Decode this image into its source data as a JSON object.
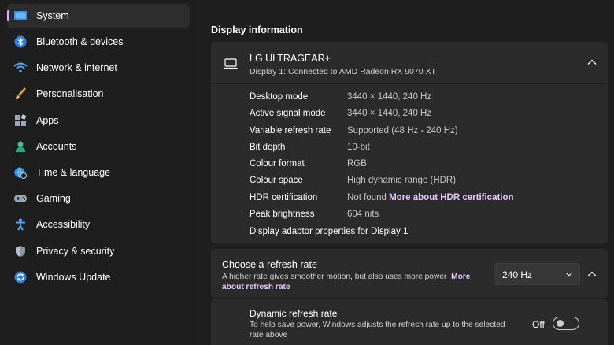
{
  "sidebar": {
    "items": [
      {
        "label": "System",
        "icon": "system-icon",
        "selected": true
      },
      {
        "label": "Bluetooth & devices",
        "icon": "bluetooth-icon"
      },
      {
        "label": "Network & internet",
        "icon": "wifi-icon"
      },
      {
        "label": "Personalisation",
        "icon": "brush-icon"
      },
      {
        "label": "Apps",
        "icon": "apps-icon"
      },
      {
        "label": "Accounts",
        "icon": "person-icon"
      },
      {
        "label": "Time & language",
        "icon": "globe-clock-icon"
      },
      {
        "label": "Gaming",
        "icon": "gamepad-icon"
      },
      {
        "label": "Accessibility",
        "icon": "accessibility-icon"
      },
      {
        "label": "Privacy & security",
        "icon": "shield-icon"
      },
      {
        "label": "Windows Update",
        "icon": "update-icon"
      }
    ]
  },
  "main": {
    "section_title": "Display information",
    "display_card": {
      "name": "LG ULTRAGEAR+",
      "subtitle": "Display 1: Connected to AMD Radeon RX 9070 XT",
      "rows": [
        {
          "label": "Desktop mode",
          "value": "3440 × 1440, 240 Hz"
        },
        {
          "label": "Active signal mode",
          "value": "3440 × 1440, 240 Hz"
        },
        {
          "label": "Variable refresh rate",
          "value": "Supported (48 Hz - 240 Hz)"
        },
        {
          "label": "Bit depth",
          "value": "10-bit"
        },
        {
          "label": "Colour format",
          "value": "RGB"
        },
        {
          "label": "Colour space",
          "value": "High dynamic range (HDR)"
        },
        {
          "label": "HDR certification",
          "value": "Not found",
          "link": "More about HDR certification"
        },
        {
          "label": "Peak brightness",
          "value": "604 nits"
        }
      ],
      "adaptor_link": "Display adaptor properties for Display 1"
    },
    "refresh_card": {
      "title": "Choose a refresh rate",
      "desc": "A higher rate gives smoother motion, but also uses more power",
      "desc_link": "More about refresh rate",
      "selected_rate": "240 Hz"
    },
    "dynamic_card": {
      "title": "Dynamic refresh rate",
      "desc": "To help save power, Windows adjusts the refresh rate up to the selected rate above",
      "toggle_label": "Off",
      "toggle_on": false
    }
  },
  "colors": {
    "accent": "#d9b3ff",
    "link": "#e6c6ff",
    "card": "#2b2b2b",
    "background": "#1f1f1f"
  }
}
